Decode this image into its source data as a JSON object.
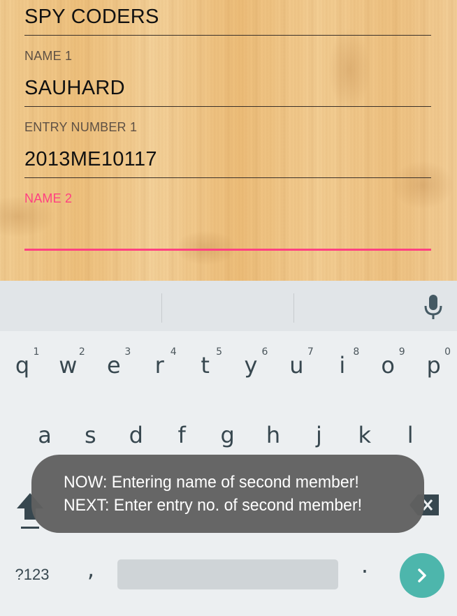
{
  "form": {
    "team_name": "SPY CODERS",
    "name1_label": "NAME 1",
    "name1_value": "SAUHARD",
    "entry1_label": "ENTRY NUMBER 1",
    "entry1_value": "2013ME10117",
    "name2_label": "NAME 2",
    "name2_value": "",
    "accent_color": "#ff4081"
  },
  "keyboard": {
    "row1": [
      {
        "key": "q",
        "hint": "1"
      },
      {
        "key": "w",
        "hint": "2"
      },
      {
        "key": "e",
        "hint": "3"
      },
      {
        "key": "r",
        "hint": "4"
      },
      {
        "key": "t",
        "hint": "5"
      },
      {
        "key": "y",
        "hint": "6"
      },
      {
        "key": "u",
        "hint": "7"
      },
      {
        "key": "i",
        "hint": "8"
      },
      {
        "key": "o",
        "hint": "9"
      },
      {
        "key": "p",
        "hint": "0"
      }
    ],
    "row2": [
      "a",
      "s",
      "d",
      "f",
      "g",
      "h",
      "j",
      "k",
      "l"
    ],
    "symbols_key": "?123",
    "comma_key": ",",
    "period_key": ".",
    "enter_color": "#4db6ac",
    "icons": [
      "microphone-icon",
      "shift-icon",
      "backspace-icon",
      "enter-arrow-icon"
    ]
  },
  "toast": {
    "line1": "NOW: Entering name of second member!",
    "line2": "NEXT: Enter entry no. of second member!"
  }
}
